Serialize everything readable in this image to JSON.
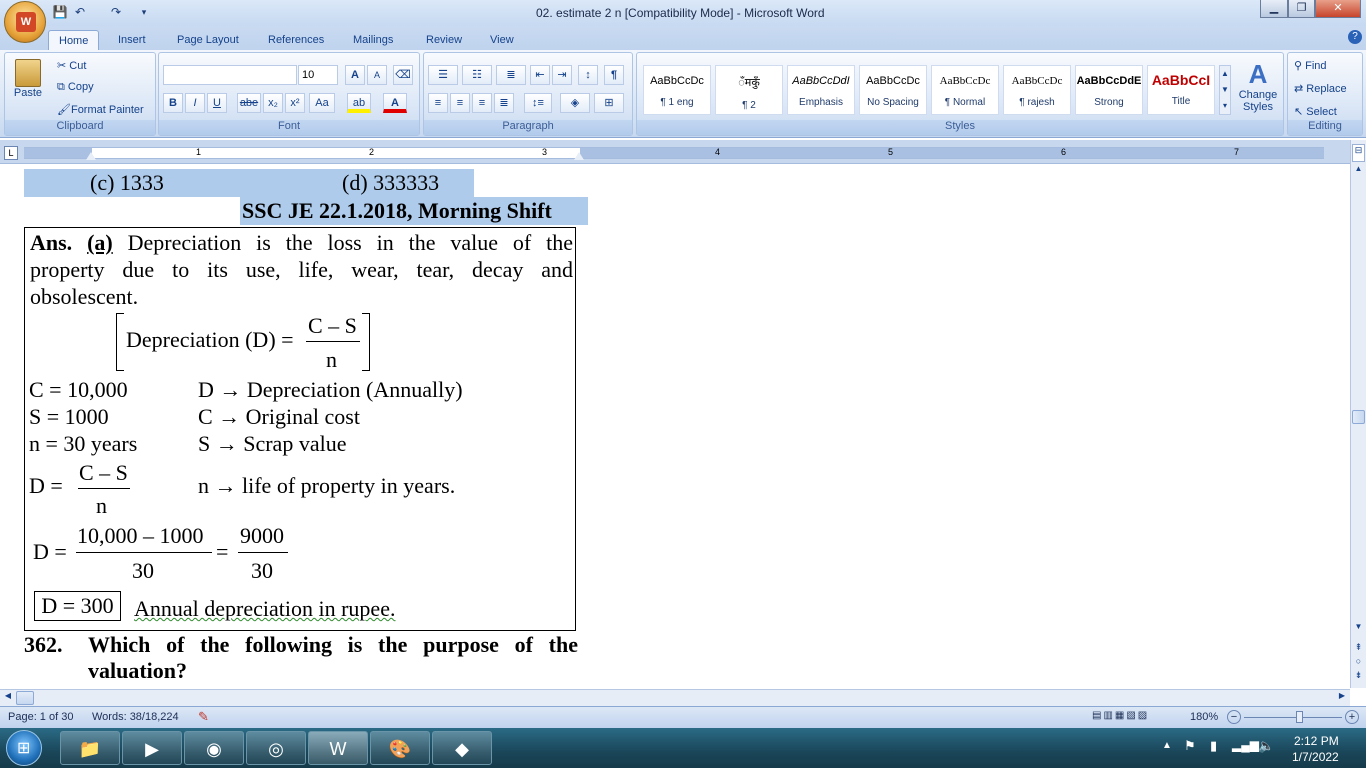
{
  "window": {
    "title": "02. estimate 2 n [Compatibility Mode] - Microsoft Word",
    "minimize": "▁",
    "maximize": "❐",
    "close": "✕",
    "help": "?"
  },
  "tabs": [
    "Home",
    "Insert",
    "Page Layout",
    "References",
    "Mailings",
    "Review",
    "View"
  ],
  "clipboard": {
    "paste": "Paste",
    "cut": "Cut",
    "copy": "Copy",
    "format_painter": "Format Painter",
    "label": "Clipboard"
  },
  "font": {
    "name": "",
    "size": "10",
    "label": "Font",
    "grow": "A",
    "shrink": "A",
    "bold": "B",
    "italic": "I",
    "underline": "U",
    "strike": "abe",
    "subscript": "x₂",
    "superscript": "x²",
    "change_case": "Aa",
    "highlight": "ab",
    "color": "A"
  },
  "paragraph": {
    "label": "Paragraph",
    "pilcrow": "¶"
  },
  "styles": {
    "label": "Styles",
    "items": [
      {
        "preview": "AaBbCcDc",
        "name": "¶ 1 eng"
      },
      {
        "preview": "ँमकुँ",
        "name": "¶ 2"
      },
      {
        "preview": "AaBbCcDdI",
        "name": "Emphasis"
      },
      {
        "preview": "AaBbCcDc",
        "name": "No Spacing"
      },
      {
        "preview": "AaBbCcDc",
        "name": "¶ Normal"
      },
      {
        "preview": "AaBbCcDc",
        "name": "¶ rajesh"
      },
      {
        "preview": "AaBbCcDdE",
        "name": "Strong"
      },
      {
        "preview": "AaBbCcI",
        "name": "Title"
      }
    ],
    "change_styles": "Change Styles"
  },
  "editing": {
    "label": "Editing",
    "find": "Find",
    "replace": "Replace",
    "select": "Select"
  },
  "document": {
    "option_c": "(c)   1333",
    "option_d": "(d)   333333",
    "source": "SSC JE 22.1.2018, Morning Shift",
    "ans_label": "Ans.",
    "ans_option": "(a)",
    "ans_text_1": "Depreciation is the loss in the value of the",
    "ans_text_2": "property due to its use, life, wear, tear, decay and",
    "ans_text_3": "obsolescent.",
    "formula_left": "Depreciation (D) =",
    "formula_num": "C – S",
    "formula_den": "n",
    "defs": [
      {
        "left": "C = 10,000",
        "right": "D → Depreciation (Annually)"
      },
      {
        "left": "S = 1000",
        "right": "C → Original cost"
      },
      {
        "left": "n = 30 years",
        "right": "S → Scrap value"
      }
    ],
    "d_eq_left": "D =",
    "d_eq_num": "C – S",
    "d_eq_den": "n",
    "n_def": "n  → life of property in years.",
    "calc_left": "D =",
    "calc_num1": "10,000 – 1000",
    "calc_den1": "30",
    "calc_eq": "=",
    "calc_num2": "9000",
    "calc_den2": "30",
    "result_box": "D = 300",
    "result_text": "Annual depreciation in rupee.",
    "q_number": "362.",
    "q_text_1": "Which of the following is the purpose of the",
    "q_text_2": "valuation?"
  },
  "ruler": {
    "numbers": [
      "1",
      "2",
      "3",
      "4",
      "5",
      "6",
      "7"
    ]
  },
  "status": {
    "page": "Page: 1 of 30",
    "words": "Words: 38/18,224",
    "zoom": "180%"
  },
  "taskbar": {
    "time": "2:12 PM",
    "date": "1/7/2022"
  }
}
